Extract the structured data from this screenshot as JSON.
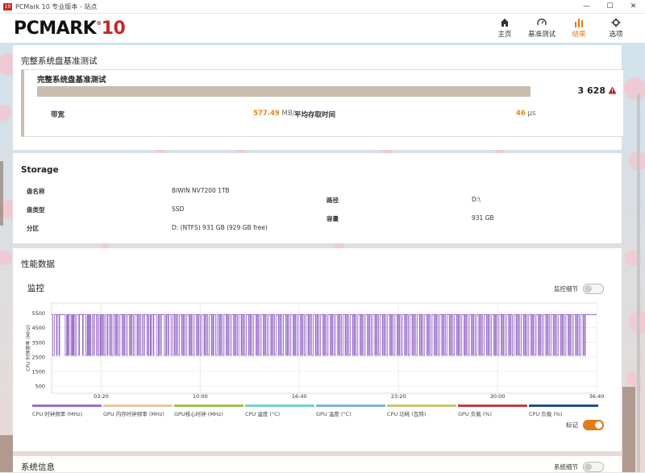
{
  "window": {
    "title": "PCMark 10 专业版本 - 站点",
    "app_icon_text": "10"
  },
  "header": {
    "logo_text": "PCMARK",
    "logo_num": "10",
    "logo_mark": "®",
    "nav": [
      {
        "label": "主页",
        "icon": "home-icon"
      },
      {
        "label": "基准测试",
        "icon": "gauge-icon"
      },
      {
        "label": "结果",
        "icon": "bar-chart-icon",
        "active": true
      },
      {
        "label": "选项",
        "icon": "gear-icon"
      }
    ]
  },
  "summary": {
    "title": "完整系统盘基准测试",
    "card_title": "完整系统盘基准测试",
    "score": "3 628",
    "bandwidth_label": "带宽",
    "bandwidth_value": "577.49",
    "bandwidth_unit": "MB/s",
    "access_label": "平均存取时间",
    "access_value": "46",
    "access_unit": "μs"
  },
  "storage": {
    "title": "Storage",
    "disk_name_label": "盘名称",
    "disk_name": "BIWIN NV7200 1TB",
    "disk_type_label": "盘类型",
    "disk_type": "SSD",
    "partition_label": "分区",
    "partition": "D: (NTFS) 931 GB (929 GB free)",
    "path_label": "路径",
    "path": "D:\\",
    "capacity_label": "容量",
    "capacity": "931 GB"
  },
  "performance": {
    "title": "性能数据",
    "monitor_title": "监控",
    "monitor_toggle_label": "监控细节",
    "markers_label": "标记",
    "legend": [
      {
        "label": "CPU 时钟频率 (MHz)",
        "color": "#9a6fc9"
      },
      {
        "label": "GPU 内存时钟频率 (MHz)",
        "color": "#e6c7a0"
      },
      {
        "label": "GPU核心时钟 (MHz)",
        "color": "#9bc04a"
      },
      {
        "label": "CPU 温度 (°C)",
        "color": "#6fd3c4"
      },
      {
        "label": "GPU 温度 (°C)",
        "color": "#7fb2d8"
      },
      {
        "label": "CPU 功耗 (瓦特)",
        "color": "#c9c36a"
      },
      {
        "label": "GPU 负载 (%)",
        "color": "#c23a48"
      },
      {
        "label": "CPU 负载 (%)",
        "color": "#234e8c"
      }
    ]
  },
  "system_info": {
    "title": "系统信息",
    "toggle_label": "系统细节"
  },
  "chart_data": {
    "type": "line",
    "ylabel": "CPU 时钟频率 (MHz)",
    "y_ticks": [
      "5500",
      "4500",
      "3500",
      "2500",
      "1500",
      "500"
    ],
    "x_ticks": [
      "03:20",
      "10:00",
      "16:40",
      "23:20",
      "30:00",
      "36:40"
    ],
    "x_ticks_seconds": [
      200,
      600,
      1000,
      1400,
      1800,
      2200
    ],
    "xlim_seconds": [
      0,
      2200
    ],
    "ylim": [
      0,
      6200
    ],
    "grid": true,
    "series": [
      {
        "name": "CPU 时钟频率 (MHz)",
        "high": 5400,
        "low": 2600,
        "dip_times_seconds": [
          5,
          20,
          30,
          55,
          62,
          68,
          78,
          82,
          88,
          95,
          110,
          125,
          138,
          146,
          152,
          158,
          170,
          182,
          190,
          198,
          205,
          212,
          225,
          235,
          242,
          255,
          262,
          270,
          285,
          292,
          300,
          315,
          322,
          330,
          345,
          352,
          360,
          372,
          385,
          392,
          400,
          410,
          425,
          432,
          440,
          455,
          462,
          470,
          482,
          495,
          502,
          510,
          525,
          532,
          540,
          555,
          562,
          570,
          585,
          592,
          600,
          615,
          622,
          630,
          645,
          652,
          662,
          675,
          682,
          690,
          705,
          712,
          720,
          735,
          742,
          750,
          765,
          772,
          780,
          795,
          802,
          810,
          825,
          832,
          840,
          855,
          862,
          870,
          885,
          892,
          900,
          915,
          922,
          930,
          945,
          952,
          960,
          975,
          982,
          990,
          1005,
          1012,
          1020,
          1035,
          1042,
          1050,
          1065,
          1072,
          1080,
          1095,
          1102,
          1110,
          1125,
          1132,
          1140,
          1155,
          1162,
          1170,
          1185,
          1192,
          1200,
          1215,
          1222,
          1230,
          1245,
          1252,
          1260,
          1275,
          1282,
          1290,
          1305,
          1312,
          1320,
          1335,
          1342,
          1350,
          1365,
          1372,
          1380,
          1395,
          1402,
          1410,
          1425,
          1432,
          1440,
          1455,
          1462,
          1470,
          1485,
          1492,
          1500,
          1515,
          1522,
          1530,
          1545,
          1552,
          1560,
          1575,
          1582,
          1590,
          1605,
          1612,
          1620,
          1635,
          1642,
          1650,
          1665,
          1672,
          1680,
          1695,
          1702,
          1710,
          1725,
          1732,
          1740,
          1755,
          1762,
          1770,
          1785,
          1792,
          1800,
          1815,
          1822,
          1830,
          1845,
          1852,
          1860,
          1875,
          1882,
          1890,
          1905,
          1912,
          1920,
          1935,
          1942,
          1950,
          1965,
          1972,
          1980,
          1995,
          2002,
          2010,
          2025,
          2032,
          2040,
          2055,
          2062,
          2070,
          2085,
          2092,
          2100,
          2115,
          2122,
          2130,
          2145,
          2152
        ],
        "end_seconds": 2200
      }
    ]
  }
}
